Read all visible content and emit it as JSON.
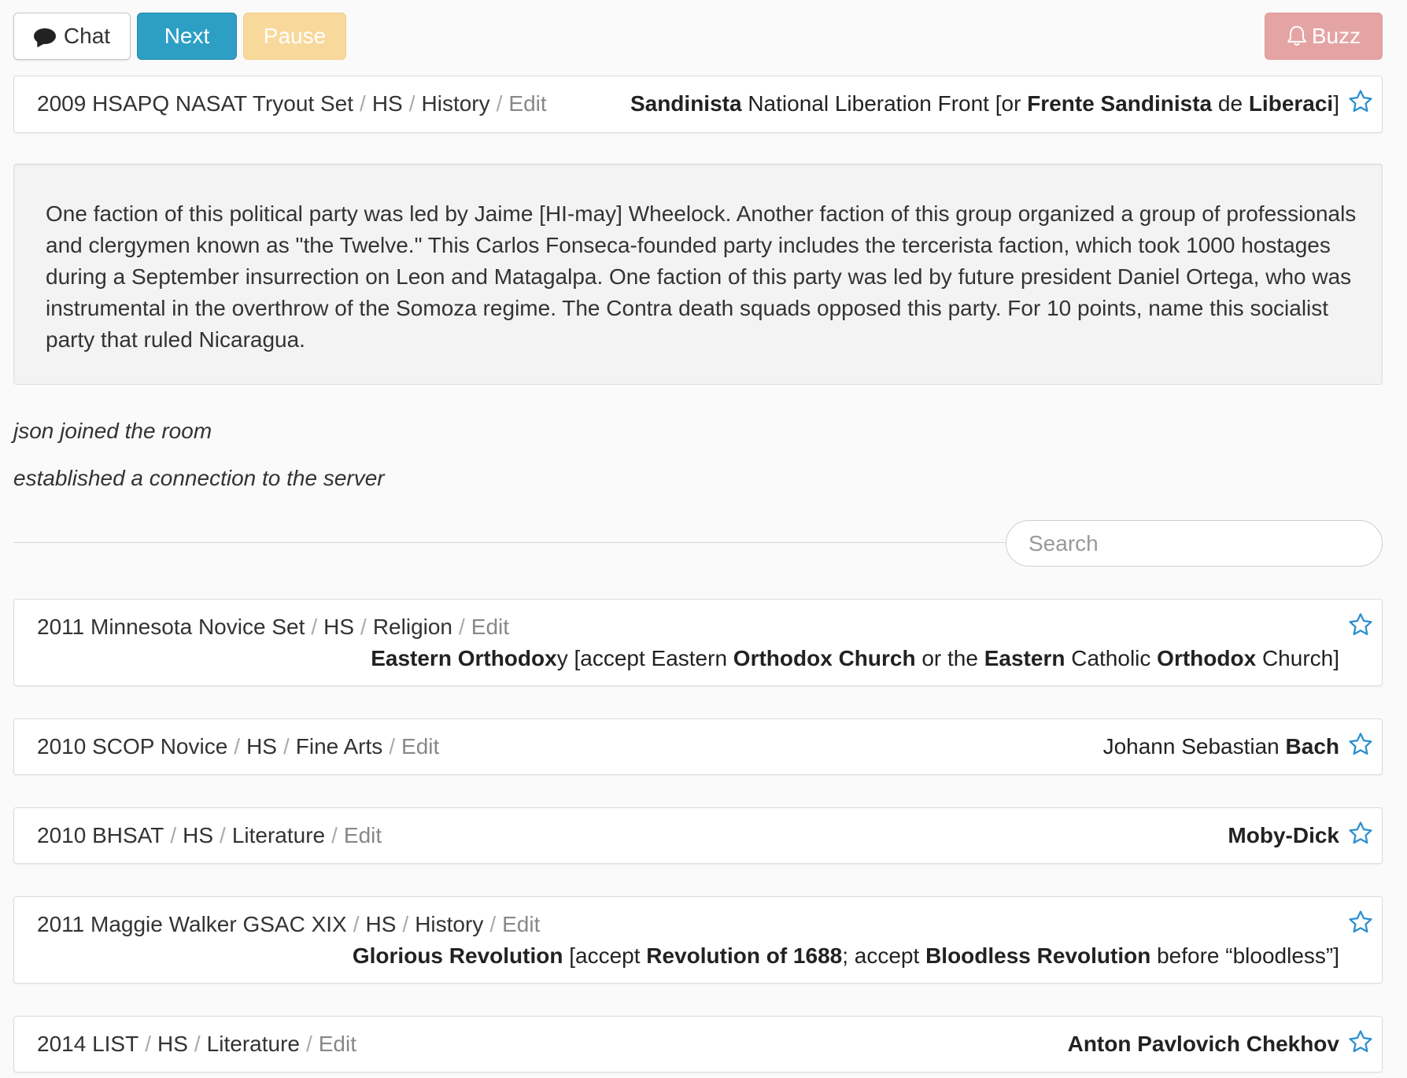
{
  "toolbar": {
    "chat_label": "Chat",
    "next_label": "Next",
    "pause_label": "Pause",
    "buzz_label": "Buzz"
  },
  "current": {
    "tournament": "2009 HSAPQ NASAT Tryout Set",
    "level": "HS",
    "category": "History",
    "edit_label": "Edit",
    "answer_parts": [
      {
        "text": "Sandinista",
        "bold": true
      },
      {
        "text": " National Liberation Front [or ",
        "bold": false
      },
      {
        "text": "Frente Sandinista",
        "bold": true
      },
      {
        "text": " de ",
        "bold": false
      },
      {
        "text": "Liberaci",
        "bold": true
      },
      {
        "text": "]",
        "bold": false
      }
    ],
    "question": "One faction of this political party was led by Jaime [HI-may] Wheelock. Another faction of this group organized a group of professionals and clergymen known as \"the Twelve.\" This Carlos Fonseca-founded party includes the tercerista faction, which took 1000 hostages during a September insurrection on Leon and Matagalpa. One faction of this party was led by future president Daniel Ortega, who was instrumental in the overthrow of the Somoza regime. The Contra death squads opposed this party. For 10 points, name this socialist party that ruled Nicaragua."
  },
  "log": [
    "json joined the room",
    "established a connection to the server"
  ],
  "search": {
    "placeholder": "Search"
  },
  "history": [
    {
      "tournament": "2011 Minnesota Novice Set",
      "level": "HS",
      "category": "Religion",
      "edit_label": "Edit",
      "answer_parts": [
        {
          "text": "Eastern Orthodox",
          "bold": true
        },
        {
          "text": "y [accept Eastern ",
          "bold": false
        },
        {
          "text": "Orthodox Church",
          "bold": true
        },
        {
          "text": " or the ",
          "bold": false
        },
        {
          "text": "Eastern",
          "bold": true
        },
        {
          "text": " Catholic ",
          "bold": false
        },
        {
          "text": "Orthodox",
          "bold": true
        },
        {
          "text": " Church]",
          "bold": false
        }
      ]
    },
    {
      "tournament": "2010 SCOP Novice",
      "level": "HS",
      "category": "Fine Arts",
      "edit_label": "Edit",
      "answer_parts": [
        {
          "text": "Johann Sebastian ",
          "bold": false
        },
        {
          "text": "Bach",
          "bold": true
        }
      ]
    },
    {
      "tournament": "2010 BHSAT",
      "level": "HS",
      "category": "Literature",
      "edit_label": "Edit",
      "answer_parts": [
        {
          "text": "Moby-Dick",
          "bold": true
        }
      ]
    },
    {
      "tournament": "2011 Maggie Walker GSAC XIX",
      "level": "HS",
      "category": "History",
      "edit_label": "Edit",
      "answer_parts": [
        {
          "text": "Glorious Revolution",
          "bold": true
        },
        {
          "text": " [accept ",
          "bold": false
        },
        {
          "text": "Revolution of 1688",
          "bold": true
        },
        {
          "text": "; accept ",
          "bold": false
        },
        {
          "text": "Bloodless Revolution",
          "bold": true
        },
        {
          "text": " before “bloodless”]",
          "bold": false
        }
      ]
    },
    {
      "tournament": "2014 LIST",
      "level": "HS",
      "category": "Literature",
      "edit_label": "Edit",
      "answer_parts": [
        {
          "text": "Anton Pavlovich Chekhov",
          "bold": true
        }
      ]
    }
  ],
  "colors": {
    "next_button": "#2d9fc4",
    "pause_button": "#f9d89b",
    "buzz_button": "#e5a4a4",
    "star": "#2a8fd0"
  },
  "icons": {
    "chat": "chat-bubble-icon",
    "buzz": "bell-icon",
    "star": "star-outline-icon"
  }
}
